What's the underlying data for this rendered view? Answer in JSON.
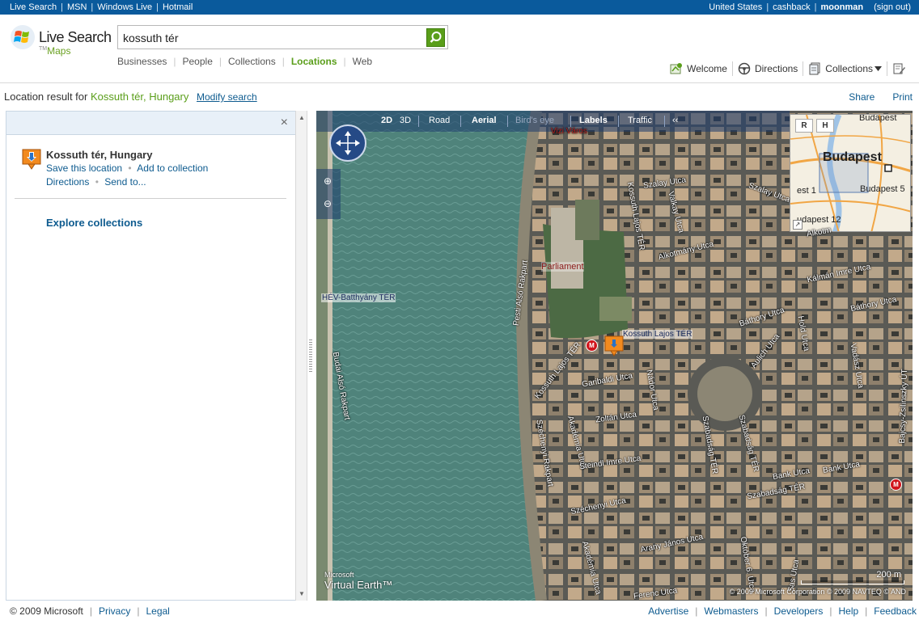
{
  "topbar": {
    "left": [
      "Live Search",
      "MSN",
      "Windows Live",
      "Hotmail"
    ],
    "right": [
      "United States",
      "cashback",
      "moonman",
      "(sign out)"
    ]
  },
  "logo": {
    "brand": "Live Search",
    "sub": "Maps",
    "tm": "TM"
  },
  "search": {
    "value": "kossuth tér",
    "placeholder": ""
  },
  "nav": {
    "tabs": [
      "Businesses",
      "People",
      "Collections",
      "Locations",
      "Web"
    ],
    "active": "Locations"
  },
  "tools": {
    "welcome": "Welcome",
    "directions": "Directions",
    "collections": "Collections"
  },
  "result": {
    "prefix": "Location result for",
    "location": "Kossuth tér, Hungary",
    "modify": "Modify search"
  },
  "toplinks": {
    "share": "Share",
    "print": "Print"
  },
  "panel": {
    "close": "×",
    "name": "Kossuth tér, Hungary",
    "save": "Save this location",
    "add": "Add to collection",
    "directions": "Directions",
    "send": "Send to...",
    "explore": "Explore collections"
  },
  "map": {
    "toolbar": [
      "2D",
      "3D",
      "Road",
      "Aerial",
      "Bird's eye",
      "Labels",
      "Traffic",
      "‹‹"
    ],
    "minimap": {
      "r": "R",
      "h": "H",
      "city": "Budapest",
      "d1": "Budapest",
      "d5": "Budapest 5",
      "d1b": "est 1",
      "d12": "udapest 12"
    },
    "streets": [
      "Vizi Város",
      "Szalay Utca",
      "Szalay Utca",
      "Kossuth Lajos TÉR",
      "Valkay Utca",
      "Alkotmány Utca",
      "Kálmán Imre Utca",
      "Báthory Utca",
      "Báthory Utca",
      "Pesti Alsó Rakpart",
      "Kossuth Lajos TÉR",
      "Garibaldi Utca",
      "Nádor Utca",
      "Aulich Utca",
      "Hold Utca",
      "Vadász Utca",
      "Zoltán Utca",
      "Akadémia Utca",
      "Széchenyi Rakpart",
      "Steindl Imre Utca",
      "Szabadság TÉR",
      "Szabadság TÉR",
      "Bank Utca",
      "Bank Utca",
      "Széchenyi Utca",
      "Szabadság TÉR",
      "Arany János Utca",
      "Akadémia Utca",
      "Október 6. Utca",
      "Sas Utca",
      "Budai Alsó Rakpart",
      "Bajcsy-Zsilinszky ÚT",
      "Ferenc Utca",
      "Alkotm"
    ],
    "poi": {
      "hev": "HÉV-Batthyány TÉR",
      "metro_label": "Kossuth Lajos TÉR",
      "parliament": "Parliament",
      "metro": "M"
    },
    "copyright": "© 2009 Microsoft Corporation   © 2009 NAVTEQ   © AND",
    "ve_small": "Microsoft",
    "ve_big": "Virtual Earth™",
    "scale": "200 m"
  },
  "footer": {
    "left": [
      "© 2009 Microsoft",
      "Privacy",
      "Legal"
    ],
    "right": [
      "Advertise",
      "Webmasters",
      "Developers",
      "Help",
      "Feedback"
    ]
  }
}
